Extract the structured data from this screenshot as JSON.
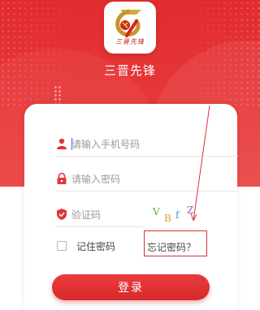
{
  "app": {
    "name": "三晋先锋",
    "logo_caption": "三晋先锋"
  },
  "form": {
    "phone_placeholder": "请输入手机号码",
    "password_placeholder": "请输入密码",
    "captcha_placeholder": "验证码",
    "captcha_chars": [
      "V",
      "B",
      "f",
      "Z"
    ],
    "remember_label": "记住密码",
    "forgot_label": "忘记密码？",
    "login_label": "登录"
  },
  "colors": {
    "brand_red": "#e22b2e",
    "icon_red": "#e2353b",
    "highlight": "#d9303a"
  },
  "icons": {
    "phone": "user-icon",
    "password": "lock-icon",
    "captcha": "shield-icon"
  }
}
